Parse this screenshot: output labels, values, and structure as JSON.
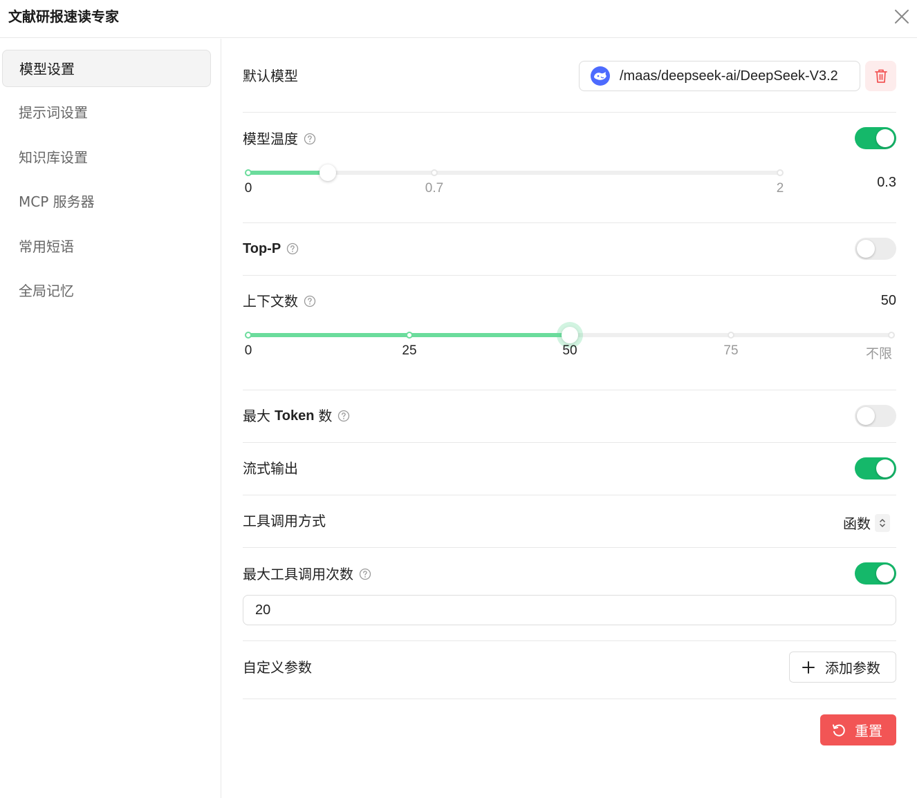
{
  "header": {
    "title": "文献研报速读专家"
  },
  "sidebar": {
    "items": [
      {
        "label": "模型设置",
        "active": true
      },
      {
        "label": "提示词设置"
      },
      {
        "label": "知识库设置"
      },
      {
        "label": "MCP 服务器"
      },
      {
        "label": "常用短语"
      },
      {
        "label": "全局记忆"
      }
    ]
  },
  "settings": {
    "default_model": {
      "label": "默认模型",
      "value": "/maas/deepseek-ai/DeepSeek-V3.2",
      "logo_icon": "deepseek-whale-icon",
      "logo_color": "#4d6bfe"
    },
    "temperature": {
      "label": "模型温度",
      "enabled": true,
      "value": "0.3",
      "min": 0,
      "max": 2,
      "current": 0.3,
      "marks": [
        "0",
        "0.7",
        "2"
      ]
    },
    "top_p": {
      "label": "Top-P",
      "enabled": false
    },
    "context_count": {
      "label": "上下文数",
      "value": "50",
      "current": 50,
      "marks": [
        "0",
        "25",
        "50",
        "75",
        "不限"
      ]
    },
    "max_tokens": {
      "label_prefix": "最大",
      "label_token": "Token",
      "label_suffix": "数",
      "enabled": false
    },
    "stream_output": {
      "label": "流式输出",
      "enabled": true
    },
    "tool_call_mode": {
      "label": "工具调用方式",
      "value": "函数"
    },
    "max_tool_calls": {
      "label": "最大工具调用次数",
      "enabled": true,
      "value": "20"
    },
    "custom_params": {
      "label": "自定义参数",
      "add_label": "添加参数"
    },
    "reset_label": "重置"
  },
  "colors": {
    "accent": "#15b86a",
    "slider_fill": "#6bdc9c",
    "danger": "#f25555",
    "danger_bg": "#fdecec"
  }
}
